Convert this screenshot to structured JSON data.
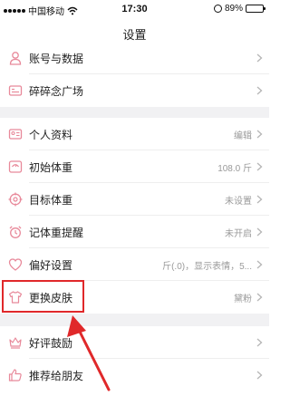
{
  "status_bar": {
    "carrier": "中国移动",
    "time": "17:30",
    "battery": "89%",
    "battery_level": 0.89
  },
  "nav": {
    "title": "设置"
  },
  "sections": [
    {
      "items": [
        {
          "label": "账号与数据",
          "value": "",
          "icon": "user-icon"
        },
        {
          "label": "碎碎念广场",
          "value": "",
          "icon": "id-card-icon"
        }
      ]
    },
    {
      "items": [
        {
          "label": "个人资料",
          "value": "编辑",
          "icon": "profile-card-icon"
        },
        {
          "label": "初始体重",
          "value": "108.0 斤",
          "icon": "scale-icon"
        },
        {
          "label": "目标体重",
          "value": "未设置",
          "icon": "target-icon"
        },
        {
          "label": "记体重提醒",
          "value": "未开启",
          "icon": "alarm-clock-icon"
        },
        {
          "label": "偏好设置",
          "value": "斤(.0)，显示表情，5...",
          "icon": "heart-icon"
        },
        {
          "label": "更换皮肤",
          "value": "黛粉",
          "icon": "tshirt-icon"
        }
      ]
    },
    {
      "items": [
        {
          "label": "好评鼓励",
          "value": "",
          "icon": "crown-icon"
        },
        {
          "label": "推荐给朋友",
          "value": "",
          "icon": "thumbs-up-icon"
        }
      ]
    }
  ],
  "colors": {
    "accent_icon": "#e8899a",
    "highlight": "#e0282a",
    "section_gap": "#f1f1f3"
  }
}
